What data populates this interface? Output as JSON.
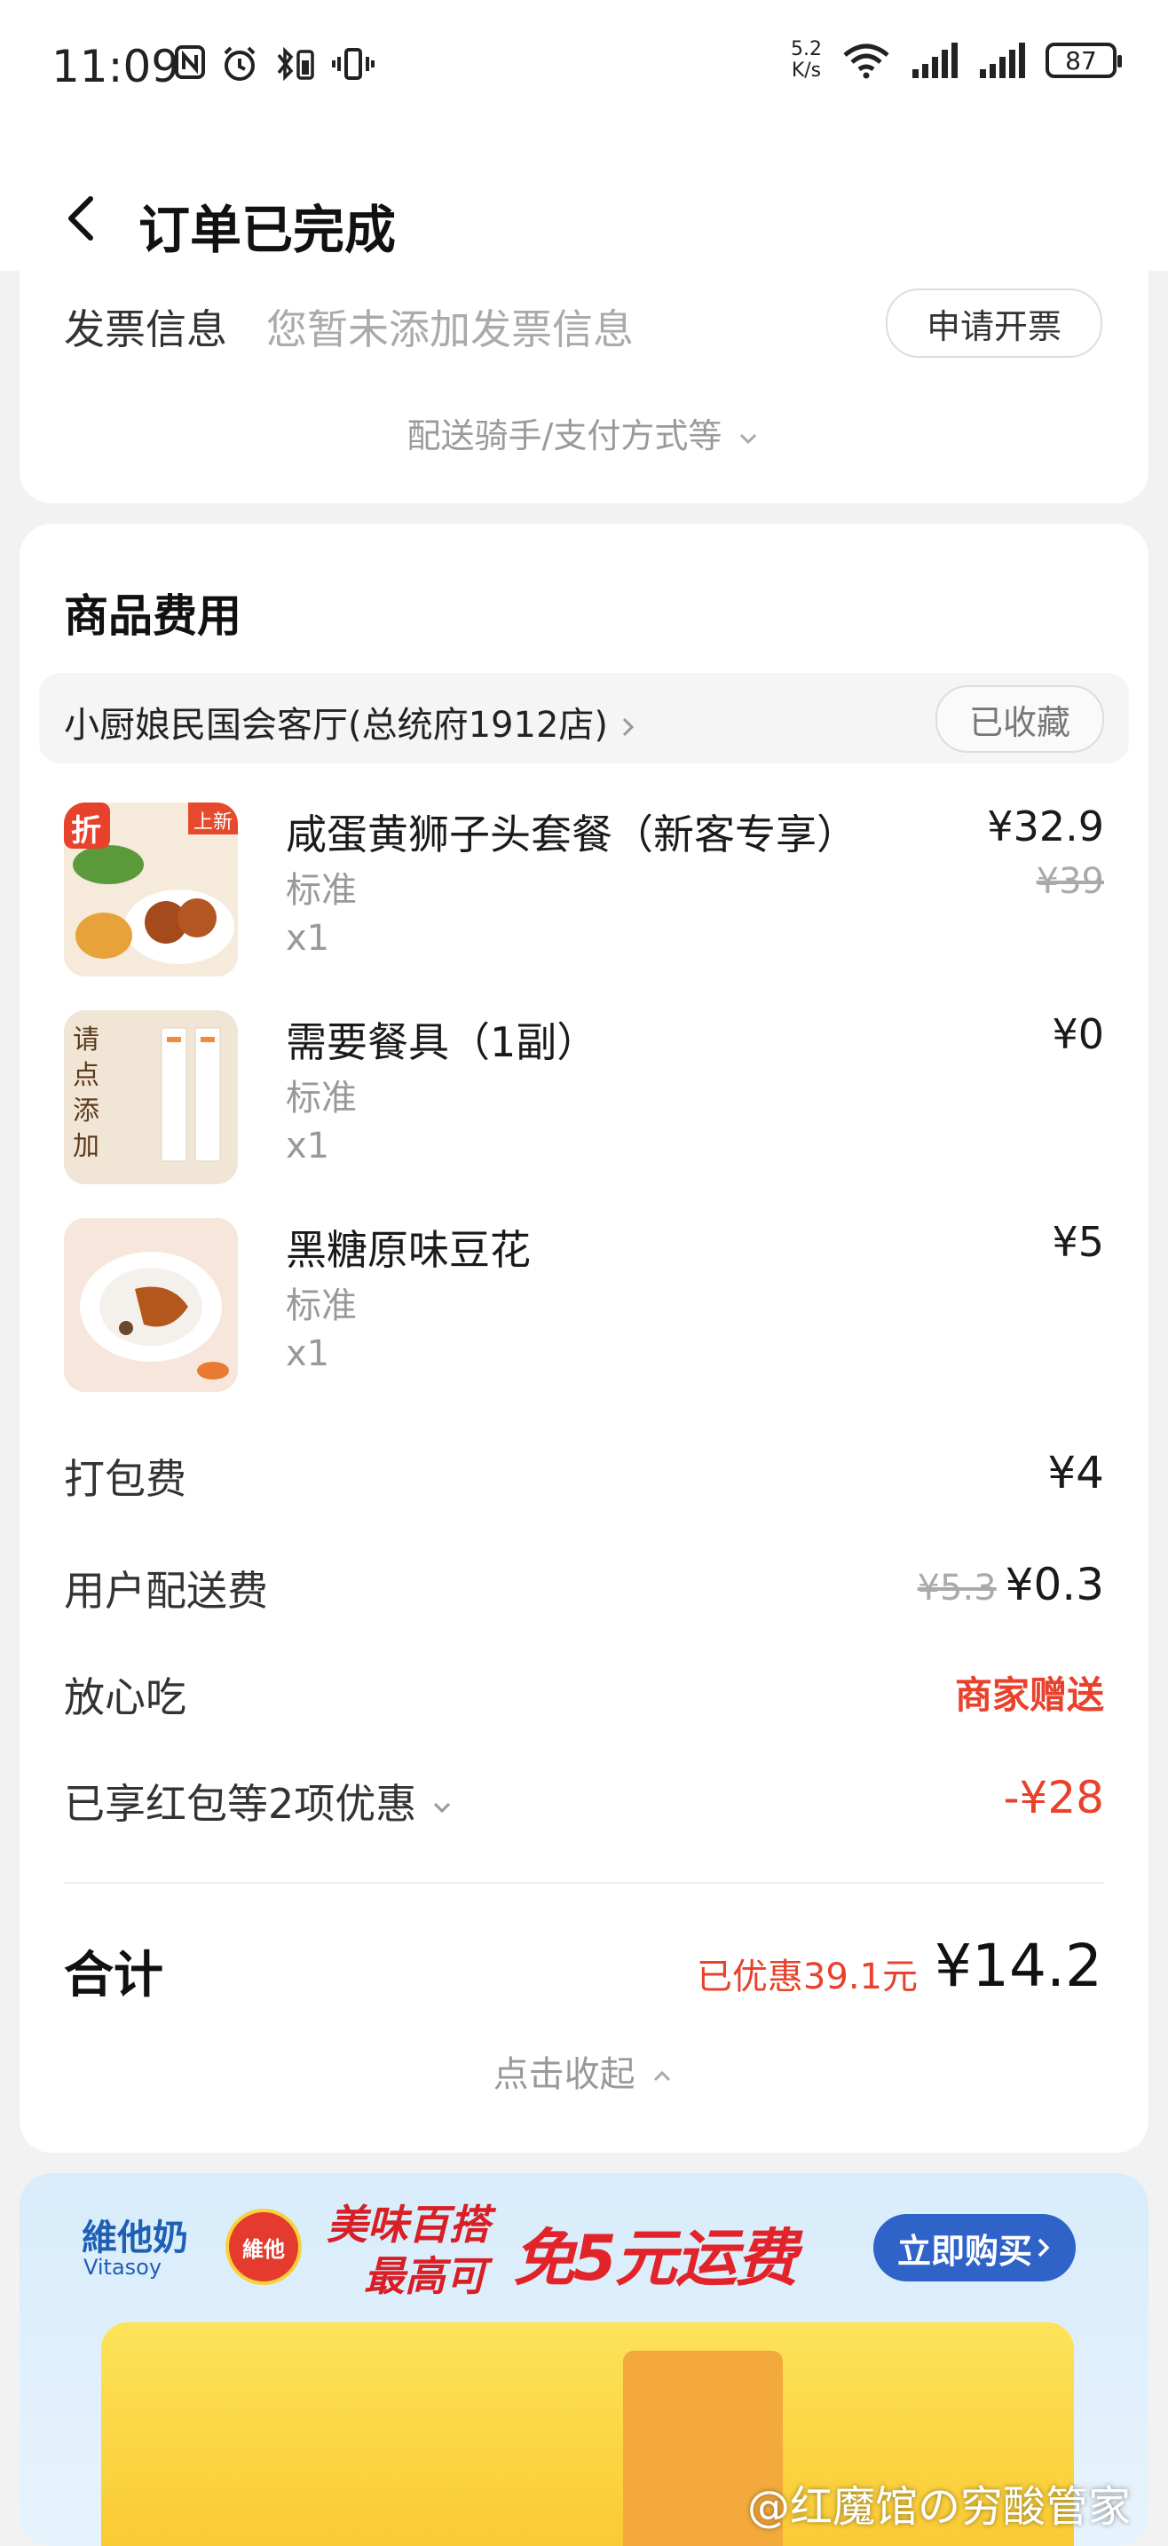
{
  "status_bar": {
    "time": "11:09",
    "net_speed_value": "5.2",
    "net_speed_unit": "K/s",
    "battery": "87"
  },
  "nav": {
    "title": "订单已完成",
    "back_icon": "chevron-left-icon"
  },
  "invoice": {
    "label": "发票信息",
    "hint": "您暂未添加发票信息",
    "button": "申请开票",
    "more_link": "配送骑手/支付方式等"
  },
  "goods": {
    "title": "商品费用",
    "shop_name": "小厨娘民国会客厅(总统府1912店)",
    "shop_fav": "已收藏",
    "items": [
      {
        "name": "咸蛋黄狮子头套餐（新客专享）",
        "spec": "标准",
        "qty": "x1",
        "price": "¥32.9",
        "original": "¥39",
        "badge": "折",
        "tag": "上新"
      },
      {
        "name": "需要餐具（1副）",
        "spec": "标准",
        "qty": "x1",
        "price": "¥0",
        "thumb_text": "请点添加"
      },
      {
        "name": "黑糖原味豆花",
        "spec": "标准",
        "qty": "x1",
        "price": "¥5"
      }
    ]
  },
  "fees": {
    "packing": {
      "label": "打包费",
      "value": "¥4"
    },
    "delivery": {
      "label": "用户配送费",
      "original": "¥5.3",
      "value": "¥0.3"
    },
    "safe_eat": {
      "label": "放心吃",
      "value": "商家赠送"
    },
    "discount": {
      "label": "已享红包等2项优惠",
      "value": "-¥28"
    }
  },
  "total": {
    "label": "合计",
    "saved": "已优惠39.1元",
    "value": "¥14.2",
    "collapse": "点击收起"
  },
  "ad": {
    "brand": "維他奶",
    "brand_sub": "Vitasoy",
    "logo_text": "維他",
    "slogan_line1": "美味百搭",
    "slogan_line2": "最高可",
    "promo": "免5元运费",
    "buy_button": "立即购买",
    "watermark": "@红魔馆の穷酸管家"
  },
  "colors": {
    "accent_red": "#e8412c",
    "ad_blue": "#2f63c8"
  }
}
